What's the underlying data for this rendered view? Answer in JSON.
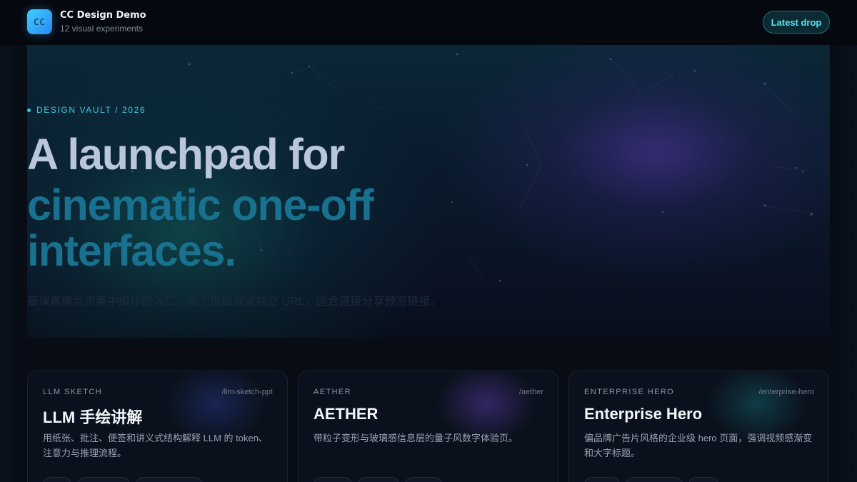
{
  "header": {
    "logo_text": "CC",
    "title": "CC Design Demo",
    "subtitle": "12 visual experiments",
    "latest_label": "Latest drop"
  },
  "hero": {
    "eyebrow": "DESIGN VAULT / 2026",
    "headline_line1": "A launchpad for",
    "headline_line2": "cinematic one-off interfaces.",
    "description": "高保真概念页集中编排的入口。每个页面保留独立 URL，适合直接分享预览链接。"
  },
  "cards": [
    {
      "tag": "LLM SKETCH",
      "path": "/llm-sketch-ppt",
      "title": "LLM 手绘讲解",
      "description": "用纸张、批注、便签和讲义式结构解释 LLM 的 token、注意力与推理流程。",
      "glow": "#1c2a6a"
    },
    {
      "tag": "AETHER",
      "path": "/aether",
      "title": "AETHER",
      "description": "带粒子变形与玻璃感信息层的量子风数字体验页。",
      "glow": "#3a2a78"
    },
    {
      "tag": "ENTERPRISE HERO",
      "path": "/enterprise-hero",
      "title": "Enterprise Hero",
      "description": "偏品牌广告片风格的企业级 hero 页面，强调视频感渐变和大字标题。",
      "glow": "#0f4a5a"
    }
  ],
  "colors": {
    "accent": "#3fc6e2",
    "headline_primary": "#b9c6dd",
    "headline_secondary": "#17718f",
    "background": "#060b14"
  }
}
